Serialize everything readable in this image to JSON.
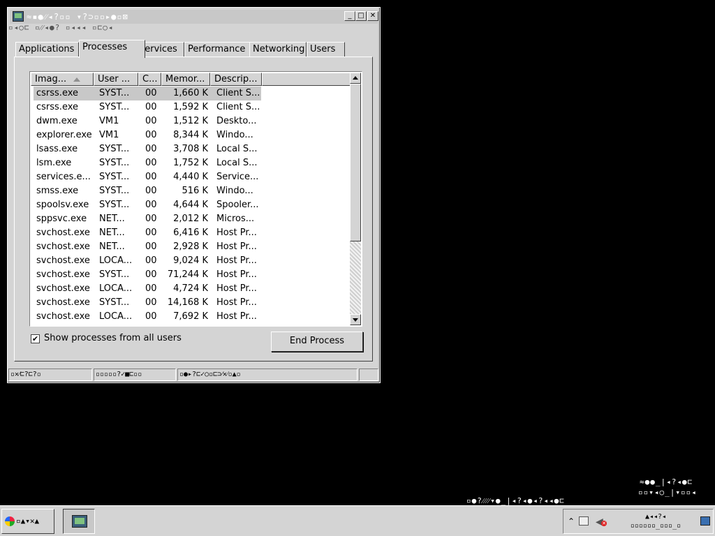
{
  "window": {
    "title_garbled": "≈▪●⁄⁄◂?▫▫ ▾?⊃▫▫▸●▫⊠",
    "menubar_garbled": "▫◂○⊏  ▫⁄⁄◂●?  ▫◂◂◂  ▫⊏○◂"
  },
  "tabs": [
    "Applications",
    "Processes",
    "Services",
    "Performance",
    "Networking",
    "Users"
  ],
  "active_tab": "Processes",
  "columns": [
    "Imag...",
    "User ...",
    "C...",
    "Memor...",
    "Descrip..."
  ],
  "processes": [
    {
      "image": "csrss.exe",
      "user": "SYST...",
      "cpu": "00",
      "mem": "1,660 K",
      "desc": "Client S..."
    },
    {
      "image": "csrss.exe",
      "user": "SYST...",
      "cpu": "00",
      "mem": "1,592 K",
      "desc": "Client S..."
    },
    {
      "image": "dwm.exe",
      "user": "VM1",
      "cpu": "00",
      "mem": "1,512 K",
      "desc": "Deskto..."
    },
    {
      "image": "explorer.exe",
      "user": "VM1",
      "cpu": "00",
      "mem": "8,344 K",
      "desc": "Windo..."
    },
    {
      "image": "lsass.exe",
      "user": "SYST...",
      "cpu": "00",
      "mem": "3,708 K",
      "desc": "Local S..."
    },
    {
      "image": "lsm.exe",
      "user": "SYST...",
      "cpu": "00",
      "mem": "1,752 K",
      "desc": "Local S..."
    },
    {
      "image": "services.e...",
      "user": "SYST...",
      "cpu": "00",
      "mem": "4,440 K",
      "desc": "Service..."
    },
    {
      "image": "smss.exe",
      "user": "SYST...",
      "cpu": "00",
      "mem": "516 K",
      "desc": "Windo..."
    },
    {
      "image": "spoolsv.exe",
      "user": "SYST...",
      "cpu": "00",
      "mem": "4,644 K",
      "desc": "Spooler..."
    },
    {
      "image": "sppsvc.exe",
      "user": "NET...",
      "cpu": "00",
      "mem": "2,012 K",
      "desc": "Micros..."
    },
    {
      "image": "svchost.exe",
      "user": "NET...",
      "cpu": "00",
      "mem": "6,416 K",
      "desc": "Host Pr..."
    },
    {
      "image": "svchost.exe",
      "user": "NET...",
      "cpu": "00",
      "mem": "2,928 K",
      "desc": "Host Pr..."
    },
    {
      "image": "svchost.exe",
      "user": "LOCA...",
      "cpu": "00",
      "mem": "9,024 K",
      "desc": "Host Pr..."
    },
    {
      "image": "svchost.exe",
      "user": "SYST...",
      "cpu": "00",
      "mem": "71,244 K",
      "desc": "Host Pr..."
    },
    {
      "image": "svchost.exe",
      "user": "LOCA...",
      "cpu": "00",
      "mem": "4,724 K",
      "desc": "Host Pr..."
    },
    {
      "image": "svchost.exe",
      "user": "SYST...",
      "cpu": "00",
      "mem": "14,168 K",
      "desc": "Host Pr..."
    },
    {
      "image": "svchost.exe",
      "user": "LOCA...",
      "cpu": "00",
      "mem": "7,692 K",
      "desc": "Host Pr..."
    }
  ],
  "selected_row": 0,
  "show_all_users": {
    "label": "Show processes from all users",
    "checked": true
  },
  "end_process_label": "End Process",
  "statusbar": {
    "seg1": "▫✕⁄⊏?⊏?▫",
    "seg2": "▫▫▫▫▫?✓■⊏▫▫",
    "seg3": "▫●▸?⊏✓○▫⊏⊃⁄✕⁄▫▲▫"
  },
  "desktop_notice": {
    "line1": "≈●●_|◂?◂●⊏",
    "line2": "▫▫▾◂○_|▾▫▫◂",
    "line3": "▫●?⁄⁄⁄⁄▾●_|◂?◂●◂?◂◂●⊏"
  },
  "taskbar": {
    "start_garbled": "▫▲▾✕▲",
    "clock_line1": "▲◂◂?◂",
    "clock_line2": "▫▫▫▫▫▫_▫▫▫_▫"
  }
}
